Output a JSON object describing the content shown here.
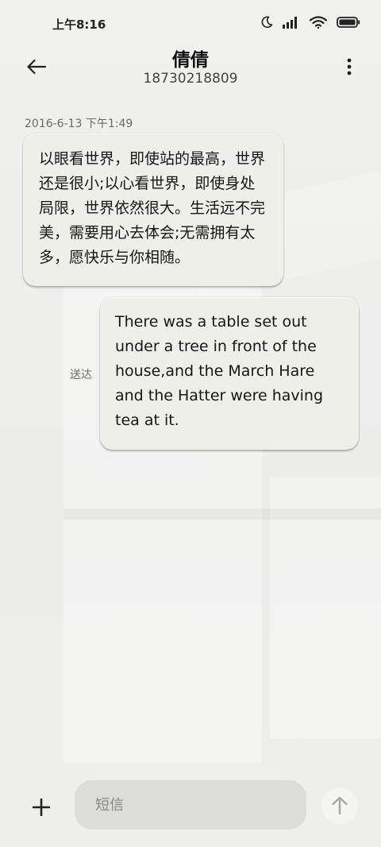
{
  "status_bar": {
    "time": "上午8:16",
    "icons": [
      "moon-icon",
      "signal-icon",
      "wifi-icon",
      "battery-icon"
    ]
  },
  "header": {
    "contact_name": "倩倩",
    "contact_number": "18730218809",
    "back_icon": "arrow-left-icon",
    "menu_icon": "more-vertical-icon"
  },
  "conversation": {
    "timestamp": "2016-6-13 下午1:49",
    "messages": [
      {
        "direction": "incoming",
        "text": "以眼看世界，即使站的最高，世界还是很小;以心看世界，即使身处局限，世界依然很大。生活远不完美，需要用心去体会;无需拥有太多，愿快乐与你相随。"
      },
      {
        "direction": "outgoing",
        "text": "There was a table set out under a tree in front of the house,and the March Hare and the Hatter were having tea at it.",
        "status": "送达"
      }
    ]
  },
  "input_bar": {
    "placeholder": "短信",
    "value": "",
    "add_icon": "plus-icon",
    "send_icon": "arrow-up-icon"
  },
  "colors": {
    "background": "#efefed",
    "bubble": "#efefea",
    "input": "#dcdcd9"
  }
}
